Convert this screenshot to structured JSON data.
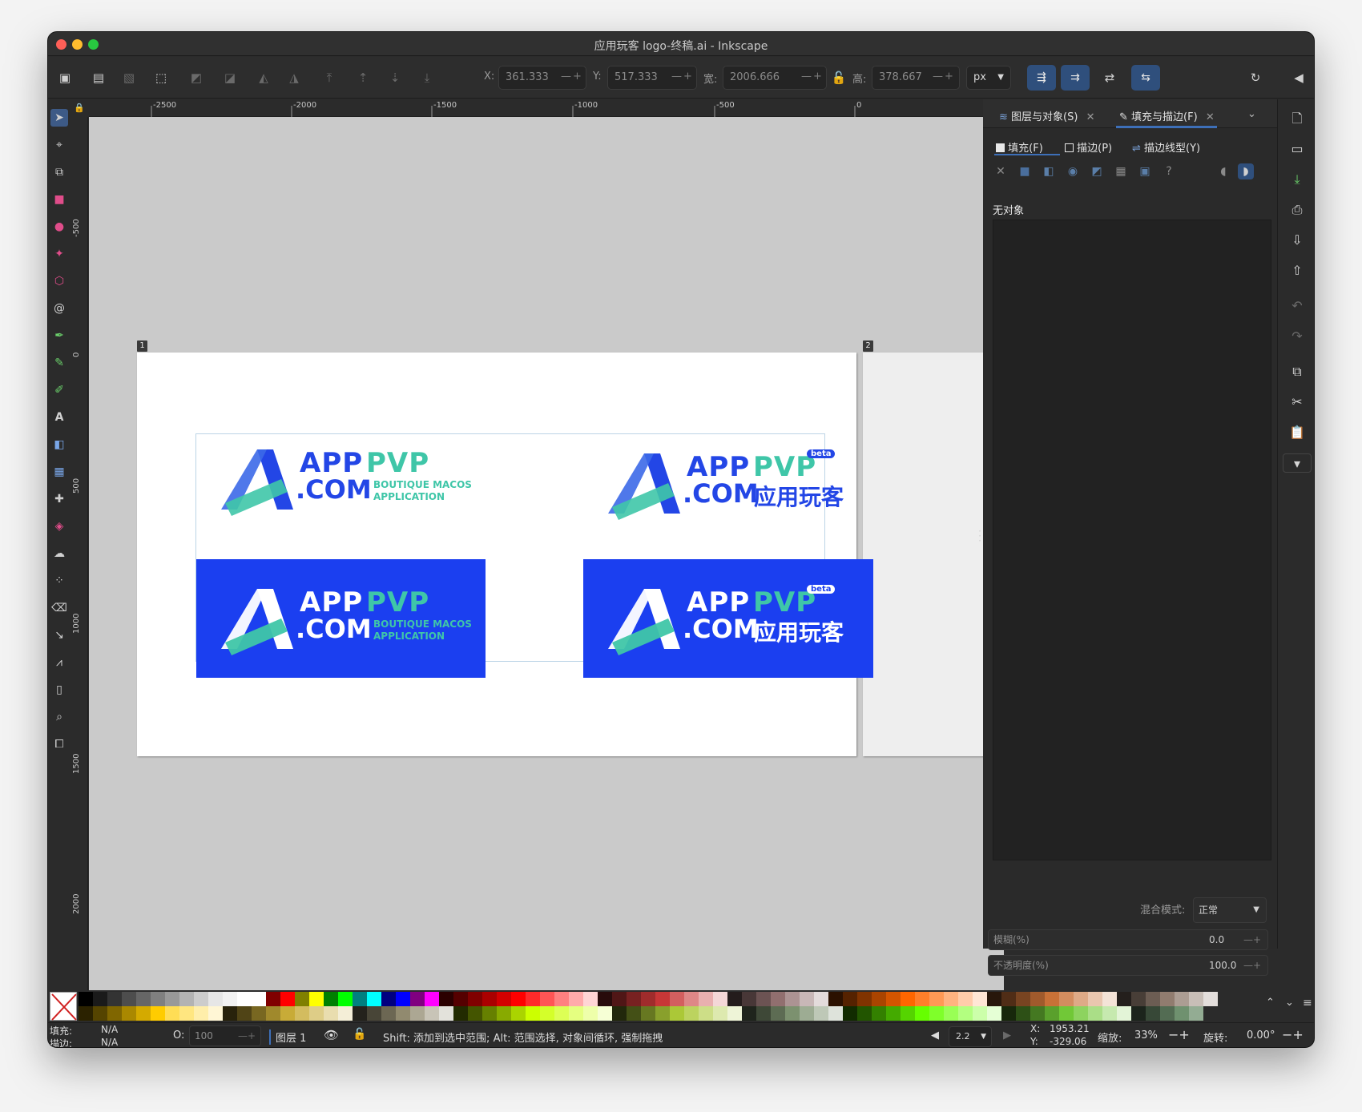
{
  "window": {
    "title": "应用玩客 logo-终稿.ai - Inkscape"
  },
  "toolbar": {
    "x_label": "X:",
    "x_value": "361.333",
    "y_label": "Y:",
    "y_value": "517.333",
    "w_label": "宽:",
    "w_value": "2006.666",
    "h_label": "高:",
    "h_value": "378.667",
    "unit": "px",
    "plus_minus": "—+"
  },
  "ruler_h": [
    "-2500",
    "-2000",
    "-1500",
    "-1000",
    "-500",
    "0"
  ],
  "ruler_v": [
    "-500",
    "0",
    "500",
    "1000",
    "1500",
    "2000"
  ],
  "pages": [
    "1",
    "2"
  ],
  "logos": {
    "app": "APP",
    "pvp": "PVP",
    "com": ".COM",
    "tagline_1": "BOUTIQUE MACOS",
    "tagline_2": "APPLICATION",
    "chinese": "应用玩客",
    "beta": "beta"
  },
  "dock": {
    "tab_layers": "图层与对象(S)",
    "tab_fill": "填充与描边(F)",
    "sub_fill": "填充(F)",
    "sub_stroke": "描边(P)",
    "sub_style": "描边线型(Y)",
    "no_object": "无对象",
    "blend_label": "混合模式:",
    "blend_value": "正常",
    "blur_label": "模糊(%)",
    "blur_value": "0.0",
    "opacity_label": "不透明度(%)",
    "opacity_value": "100.0"
  },
  "status": {
    "fill_label": "填充:",
    "fill_value": "N/A",
    "stroke_label": "描边:",
    "stroke_value": "N/A",
    "o_label": "O:",
    "o_value": "100",
    "layer": "图层 1",
    "message": "Shift: 添加到选中范围; Alt: 范围选择, 对象间循环, 强制拖拽",
    "snap": "2.2",
    "coord_x_label": "X:",
    "coord_x": "1953.21",
    "coord_y_label": "Y:",
    "coord_y": "-329.06",
    "zoom_label": "缩放:",
    "zoom_value": "33%",
    "rotate_label": "旋转:",
    "rotate_value": "0.00°"
  },
  "colors": {
    "brand_blue": "#1b3ff0",
    "logo_teal": "#3fc6a8",
    "logo_blue": "#2346e6"
  }
}
